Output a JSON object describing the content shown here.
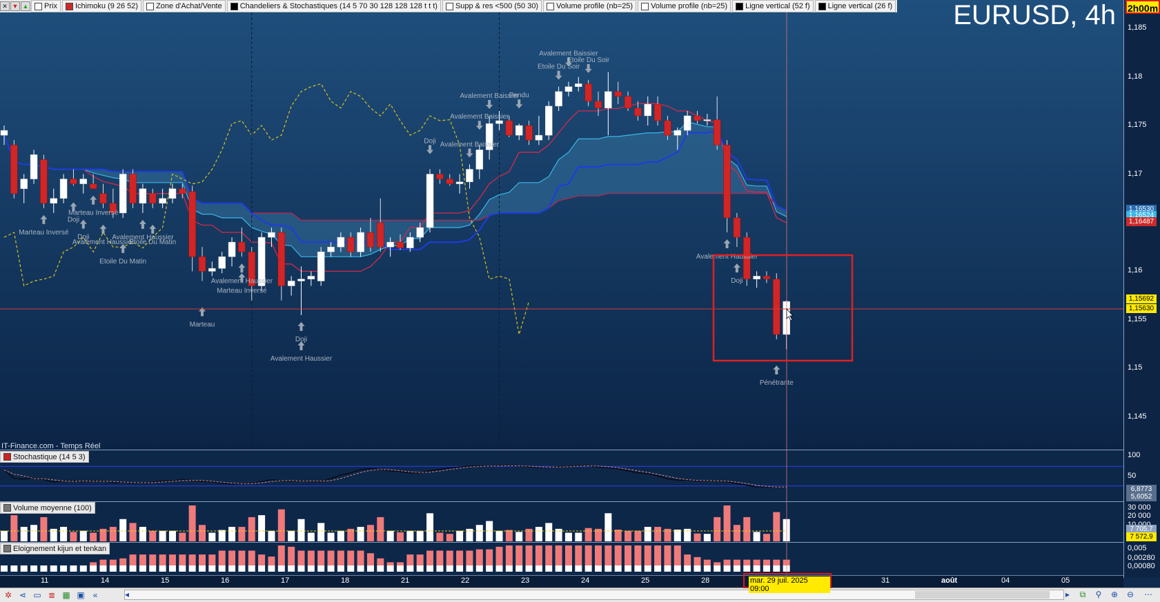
{
  "window": {
    "chart_title": "EURUSD, 4h",
    "timer": "2h00m",
    "watermark": "IT-Finance.com - Temps Réel",
    "cursor_datetime": "mar. 29 juil. 2025 09:00"
  },
  "legend": {
    "sys_icons": [
      "cross-icon",
      "down-arrow-icon",
      "up-arrow-icon"
    ],
    "items": [
      {
        "label": "Prix",
        "color": "#ffffff"
      },
      {
        "label": "Ichimoku (9 26 52)",
        "color": "#cc2a2a"
      },
      {
        "label": "Zone d'Achat/Vente",
        "color": "#ffffff"
      },
      {
        "label": "Chandeliers & Stochastiques (14 5 70 30 128 128 128 t t t)",
        "color": "#000000"
      },
      {
        "label": "Supp & res <500 (50 30)",
        "color": "#ffffff"
      },
      {
        "label": "Volume profile (nb=25)",
        "color": "#ffffff"
      },
      {
        "label": "Volume profile (nb=25)",
        "color": "#ffffff"
      },
      {
        "label": "Ligne vertical (52 f)",
        "color": "#000000"
      },
      {
        "label": "Ligne vertical (26 f)",
        "color": "#000000"
      }
    ]
  },
  "price_axis": {
    "labels": [
      "1,185",
      "1,18",
      "1,175",
      "1,17",
      "1,165",
      "1,16",
      "1,155",
      "1,15",
      "1,145"
    ],
    "tags": [
      {
        "label": "1,16530",
        "color": "#2b6cb0"
      },
      {
        "label": "1,16524",
        "color": "#3ab8e8"
      },
      {
        "label": "1,16487",
        "color": "#cc2a2a"
      },
      {
        "label": "1,15692",
        "color": "#ffea00"
      },
      {
        "label": "1,15630",
        "color": "#ffea00"
      }
    ]
  },
  "stoch_panel": {
    "title": "Stochastique (14 5 3)",
    "axis_labels": [
      "100",
      "50",
      "0"
    ],
    "tags": [
      "6,8773",
      "5,6052"
    ]
  },
  "volume_panel": {
    "title": "Volume moyenne (100)",
    "axis_labels": [
      "30 000",
      "20 000",
      "10 000"
    ],
    "tags": [
      "7 705,7",
      "7 572,9"
    ]
  },
  "kijun_panel": {
    "title": "Eloignement kijun et tenkan",
    "axis_labels": [
      "0,005",
      "0,00280",
      "0,00080"
    ]
  },
  "time_axis": {
    "labels": [
      "11",
      "14",
      "15",
      "16",
      "17",
      "18",
      "21",
      "22",
      "23",
      "24",
      "25",
      "28",
      "31",
      "août",
      "04",
      "05"
    ]
  },
  "patterns": [
    "Marteau Inversé",
    "Doji",
    "Doji",
    "Marteau Inversé",
    "Avalement Haussier",
    "Etoile Du Matin",
    "Avalement Haussier",
    "Etoile Du Matin",
    "Marteau",
    "Avalement Haussier",
    "Marteau Inversé",
    "Avalement Haussier",
    "Doji",
    "Doji",
    "Avalement Baissier",
    "Avalement Baissier",
    "Avalement Baissier",
    "Pendu",
    "Etoile Du Soir",
    "Avalement Baissier",
    "Etoile Du Soir",
    "Avalement Haussier",
    "Doji",
    "Pénétrante"
  ],
  "toolbar": {
    "icons": [
      "settings-icon",
      "share-icon",
      "chat-icon",
      "list-icon",
      "grid-icon",
      "monitor-icon",
      "rewind-icon",
      "scroll-left-icon",
      "scroll-right-icon",
      "zoom-fit-icon",
      "zoom-search-icon",
      "zoom-in-icon",
      "zoom-out-icon",
      "toggle-icon"
    ]
  },
  "chart_data": {
    "type": "candlestick",
    "title": "EURUSD, 4h",
    "ylim": [
      1.1425,
      1.1865
    ],
    "grid": false,
    "candles": [
      {
        "o": 1.174,
        "h": 1.175,
        "l": 1.173,
        "c": 1.1745
      },
      {
        "o": 1.173,
        "h": 1.1735,
        "l": 1.1675,
        "c": 1.168
      },
      {
        "o": 1.1685,
        "h": 1.17,
        "l": 1.167,
        "c": 1.1695
      },
      {
        "o": 1.1695,
        "h": 1.1725,
        "l": 1.169,
        "c": 1.172
      },
      {
        "o": 1.1715,
        "h": 1.172,
        "l": 1.1665,
        "c": 1.167
      },
      {
        "o": 1.167,
        "h": 1.1685,
        "l": 1.166,
        "c": 1.1675
      },
      {
        "o": 1.1675,
        "h": 1.17,
        "l": 1.167,
        "c": 1.1695
      },
      {
        "o": 1.1695,
        "h": 1.1705,
        "l": 1.1688,
        "c": 1.169
      },
      {
        "o": 1.169,
        "h": 1.17,
        "l": 1.168,
        "c": 1.1695
      },
      {
        "o": 1.169,
        "h": 1.17,
        "l": 1.1685,
        "c": 1.1685
      },
      {
        "o": 1.168,
        "h": 1.169,
        "l": 1.1665,
        "c": 1.167
      },
      {
        "o": 1.167,
        "h": 1.1685,
        "l": 1.1655,
        "c": 1.166
      },
      {
        "o": 1.166,
        "h": 1.1705,
        "l": 1.1655,
        "c": 1.17
      },
      {
        "o": 1.17,
        "h": 1.1705,
        "l": 1.1665,
        "c": 1.167
      },
      {
        "o": 1.167,
        "h": 1.169,
        "l": 1.166,
        "c": 1.1685
      },
      {
        "o": 1.168,
        "h": 1.1685,
        "l": 1.1665,
        "c": 1.167
      },
      {
        "o": 1.167,
        "h": 1.1685,
        "l": 1.1665,
        "c": 1.1675
      },
      {
        "o": 1.1675,
        "h": 1.169,
        "l": 1.167,
        "c": 1.1685
      },
      {
        "o": 1.1685,
        "h": 1.169,
        "l": 1.1675,
        "c": 1.168
      },
      {
        "o": 1.1682,
        "h": 1.1688,
        "l": 1.16,
        "c": 1.1615
      },
      {
        "o": 1.1615,
        "h": 1.1625,
        "l": 1.159,
        "c": 1.16
      },
      {
        "o": 1.16,
        "h": 1.161,
        "l": 1.1595,
        "c": 1.1603
      },
      {
        "o": 1.1603,
        "h": 1.162,
        "l": 1.1598,
        "c": 1.1615
      },
      {
        "o": 1.1615,
        "h": 1.1635,
        "l": 1.1605,
        "c": 1.163
      },
      {
        "o": 1.163,
        "h": 1.1645,
        "l": 1.1615,
        "c": 1.162
      },
      {
        "o": 1.162,
        "h": 1.1625,
        "l": 1.157,
        "c": 1.1585
      },
      {
        "o": 1.1585,
        "h": 1.164,
        "l": 1.158,
        "c": 1.1635
      },
      {
        "o": 1.1635,
        "h": 1.1645,
        "l": 1.1625,
        "c": 1.164
      },
      {
        "o": 1.164,
        "h": 1.1645,
        "l": 1.157,
        "c": 1.1585
      },
      {
        "o": 1.1585,
        "h": 1.1595,
        "l": 1.1575,
        "c": 1.159
      },
      {
        "o": 1.159,
        "h": 1.1605,
        "l": 1.1555,
        "c": 1.1592
      },
      {
        "o": 1.1592,
        "h": 1.16,
        "l": 1.1585,
        "c": 1.1595
      },
      {
        "o": 1.159,
        "h": 1.1625,
        "l": 1.1585,
        "c": 1.162
      },
      {
        "o": 1.162,
        "h": 1.163,
        "l": 1.1615,
        "c": 1.1625
      },
      {
        "o": 1.1625,
        "h": 1.164,
        "l": 1.162,
        "c": 1.1635
      },
      {
        "o": 1.1635,
        "h": 1.164,
        "l": 1.1615,
        "c": 1.162
      },
      {
        "o": 1.162,
        "h": 1.1645,
        "l": 1.1615,
        "c": 1.164
      },
      {
        "o": 1.164,
        "h": 1.1655,
        "l": 1.162,
        "c": 1.1625
      },
      {
        "o": 1.165,
        "h": 1.1675,
        "l": 1.162,
        "c": 1.1625
      },
      {
        "o": 1.1625,
        "h": 1.1635,
        "l": 1.1615,
        "c": 1.163
      },
      {
        "o": 1.163,
        "h": 1.1638,
        "l": 1.1622,
        "c": 1.1624
      },
      {
        "o": 1.1624,
        "h": 1.164,
        "l": 1.162,
        "c": 1.1635
      },
      {
        "o": 1.1635,
        "h": 1.165,
        "l": 1.163,
        "c": 1.1645
      },
      {
        "o": 1.1645,
        "h": 1.1705,
        "l": 1.164,
        "c": 1.17
      },
      {
        "o": 1.17,
        "h": 1.1705,
        "l": 1.169,
        "c": 1.1695
      },
      {
        "o": 1.1695,
        "h": 1.17,
        "l": 1.1688,
        "c": 1.169
      },
      {
        "o": 1.169,
        "h": 1.17,
        "l": 1.168,
        "c": 1.1692
      },
      {
        "o": 1.1692,
        "h": 1.171,
        "l": 1.1685,
        "c": 1.1705
      },
      {
        "o": 1.1705,
        "h": 1.173,
        "l": 1.1695,
        "c": 1.1725
      },
      {
        "o": 1.1725,
        "h": 1.176,
        "l": 1.1715,
        "c": 1.1752
      },
      {
        "o": 1.1752,
        "h": 1.1765,
        "l": 1.1745,
        "c": 1.1755
      },
      {
        "o": 1.1755,
        "h": 1.176,
        "l": 1.1738,
        "c": 1.174
      },
      {
        "o": 1.174,
        "h": 1.1752,
        "l": 1.1735,
        "c": 1.175
      },
      {
        "o": 1.175,
        "h": 1.1755,
        "l": 1.173,
        "c": 1.1735
      },
      {
        "o": 1.1735,
        "h": 1.176,
        "l": 1.173,
        "c": 1.174
      },
      {
        "o": 1.174,
        "h": 1.1775,
        "l": 1.1735,
        "c": 1.177
      },
      {
        "o": 1.177,
        "h": 1.179,
        "l": 1.1765,
        "c": 1.1785
      },
      {
        "o": 1.1785,
        "h": 1.1795,
        "l": 1.178,
        "c": 1.179
      },
      {
        "o": 1.179,
        "h": 1.18,
        "l": 1.1785,
        "c": 1.1793
      },
      {
        "o": 1.1793,
        "h": 1.1797,
        "l": 1.177,
        "c": 1.1775
      },
      {
        "o": 1.1775,
        "h": 1.1785,
        "l": 1.176,
        "c": 1.1768
      },
      {
        "o": 1.1768,
        "h": 1.1805,
        "l": 1.174,
        "c": 1.1785
      },
      {
        "o": 1.1785,
        "h": 1.1795,
        "l": 1.1772,
        "c": 1.178
      },
      {
        "o": 1.178,
        "h": 1.1785,
        "l": 1.1765,
        "c": 1.1768
      },
      {
        "o": 1.1768,
        "h": 1.1775,
        "l": 1.1755,
        "c": 1.176
      },
      {
        "o": 1.176,
        "h": 1.178,
        "l": 1.175,
        "c": 1.1772
      },
      {
        "o": 1.1772,
        "h": 1.178,
        "l": 1.175,
        "c": 1.1755
      },
      {
        "o": 1.1755,
        "h": 1.176,
        "l": 1.1735,
        "c": 1.174
      },
      {
        "o": 1.174,
        "h": 1.1748,
        "l": 1.1725,
        "c": 1.1745
      },
      {
        "o": 1.1745,
        "h": 1.1765,
        "l": 1.174,
        "c": 1.176
      },
      {
        "o": 1.176,
        "h": 1.1765,
        "l": 1.1752,
        "c": 1.1755
      },
      {
        "o": 1.1755,
        "h": 1.1762,
        "l": 1.175,
        "c": 1.1756
      },
      {
        "o": 1.1756,
        "h": 1.178,
        "l": 1.1725,
        "c": 1.173
      },
      {
        "o": 1.173,
        "h": 1.1735,
        "l": 1.164,
        "c": 1.1655
      },
      {
        "o": 1.1655,
        "h": 1.166,
        "l": 1.1625,
        "c": 1.1635
      },
      {
        "o": 1.1635,
        "h": 1.164,
        "l": 1.1585,
        "c": 1.1592
      },
      {
        "o": 1.1592,
        "h": 1.16,
        "l": 1.1583,
        "c": 1.1595
      },
      {
        "o": 1.1595,
        "h": 1.16,
        "l": 1.1588,
        "c": 1.1592
      },
      {
        "o": 1.1592,
        "h": 1.1598,
        "l": 1.153,
        "c": 1.1535
      },
      {
        "o": 1.1535,
        "h": 1.157,
        "l": 1.152,
        "c": 1.1569
      }
    ]
  }
}
